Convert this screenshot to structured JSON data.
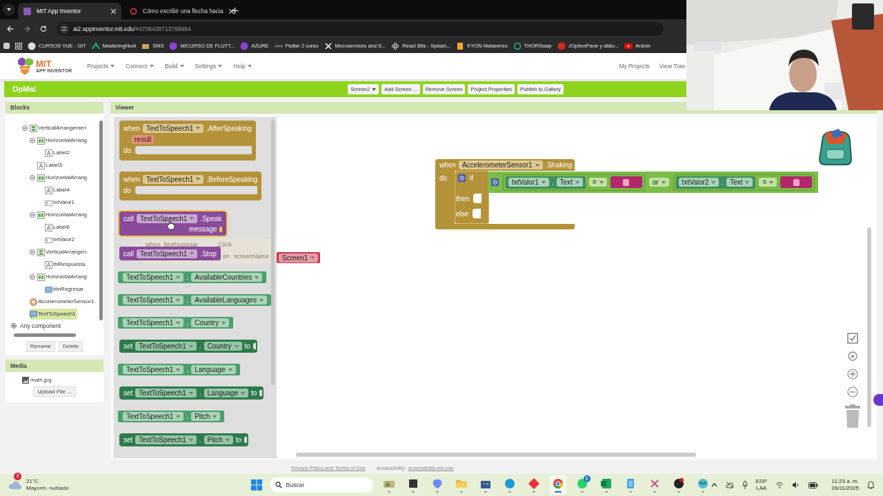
{
  "browser": {
    "tabs": [
      {
        "title": "MIT App Inventor",
        "selected": true
      },
      {
        "title": "Cómo escribir una flecha hacia",
        "selected": false
      }
    ],
    "address": {
      "host": "ai2.appinventor.mit.edu",
      "path": "/#4706438713769984"
    },
    "bookmarks": [
      {
        "label": "CURSOS VUE - GIT",
        "kind": "round"
      },
      {
        "label": "MasteringNuxt",
        "kind": "nuxt"
      },
      {
        "label": "SMS",
        "kind": "mail"
      },
      {
        "label": "MICURSO DE FLUTT...",
        "kind": "shield"
      },
      {
        "label": "AZURE",
        "kind": "shield"
      },
      {
        "label": "Flutter 2 curso",
        "kind": "dots"
      },
      {
        "label": "Microservices and S...",
        "kind": "x"
      },
      {
        "label": "React Bits - Splash...",
        "kind": "atom"
      },
      {
        "label": "KYON Metaverso",
        "kind": "bookmark"
      },
      {
        "label": "THORSwap",
        "kind": "ring"
      },
      {
        "label": "JOptionPane y diálo...",
        "kind": "java"
      },
      {
        "label": "Arduin",
        "kind": "play"
      }
    ]
  },
  "app": {
    "logo_title": "MIT",
    "logo_subtitle": "APP INVENTOR",
    "nav": [
      "Projects",
      "Connect",
      "Build",
      "Settings",
      "Help"
    ],
    "nav_right": [
      "My Projects",
      "View Tras"
    ],
    "project": "OpMat",
    "screen": "Screen2",
    "toolbar": [
      "Add Screen ...",
      "Remove Screen",
      "Project Properties",
      "Publish to Gallery"
    ]
  },
  "blocks_panel": {
    "title": "Blocks",
    "tree": [
      {
        "label": "VerticalArrangemen",
        "kind": "vertical",
        "expanded": true,
        "selected": false,
        "children": [
          {
            "label": "HorizontalArrang",
            "kind": "horizontal",
            "expanded": true,
            "selected": false,
            "children": [
              {
                "label": "Label2",
                "kind": "label",
                "selected": false
              }
            ]
          },
          {
            "label": "Label3",
            "kind": "label",
            "selected": false
          },
          {
            "label": "HorizontalArrang",
            "kind": "horizontal",
            "expanded": true,
            "selected": false,
            "children": [
              {
                "label": "Label4",
                "kind": "label",
                "selected": false
              },
              {
                "label": "txtValor1",
                "kind": "textbox",
                "selected": false
              }
            ]
          },
          {
            "label": "HorizontalArrang",
            "kind": "horizontal",
            "expanded": true,
            "selected": false,
            "children": [
              {
                "label": "Label6",
                "kind": "label",
                "selected": false
              },
              {
                "label": "txtValor2",
                "kind": "textbox",
                "selected": false
              }
            ]
          },
          {
            "label": "VerticalArrangen",
            "kind": "vertical",
            "expanded": true,
            "selected": false,
            "children": [
              {
                "label": "lblRespuesta",
                "kind": "label",
                "selected": false
              }
            ]
          },
          {
            "label": "HorizontalArrang",
            "kind": "horizontal",
            "expanded": true,
            "selected": false,
            "children": [
              {
                "label": "btnRegresar",
                "kind": "button",
                "selected": false
              }
            ]
          }
        ]
      },
      {
        "label": "AccelerometerSensor1",
        "kind": "sensor",
        "selected": false
      },
      {
        "label": "TextToSpeech1",
        "kind": "speech",
        "selected": true
      }
    ],
    "any": {
      "label": "Any component",
      "expanded": false
    },
    "buttons": [
      "Rename",
      "Delete"
    ]
  },
  "media_panel": {
    "title": "Media",
    "files": [
      "math.jpg"
    ],
    "upload": "Upload File ..."
  },
  "viewer": {
    "title": "Viewer",
    "drawer": [
      {
        "kind": "event",
        "keyword": "when",
        "component": "TextToSpeech1",
        "member": ".AfterSpeaking",
        "param": "result",
        "body": "do",
        "selected": false
      },
      {
        "kind": "event",
        "keyword": "when",
        "component": "TextToSpeech1",
        "member": ".BeforeSpeaking",
        "body": "do",
        "selected": false
      },
      {
        "kind": "call",
        "keyword": "call",
        "component": "TextToSpeech1",
        "member": ".Speak",
        "arg": "message",
        "selected": true
      },
      {
        "kind": "call",
        "keyword": "call",
        "component": "TextToSpeech1",
        "member": ".Stop",
        "selected": false
      },
      {
        "kind": "getter",
        "component": "TextToSpeech1",
        "separator": ".",
        "property": "AvailableCountries",
        "selected": false
      },
      {
        "kind": "getter",
        "component": "TextToSpeech1",
        "separator": ".",
        "property": "AvailableLanguages",
        "selected": false
      },
      {
        "kind": "getter",
        "component": "TextToSpeech1",
        "separator": ".",
        "property": "Country",
        "selected": false
      },
      {
        "kind": "setter",
        "keyword": "set",
        "component": "TextToSpeech1",
        "separator": ".",
        "property": "Country",
        "to": "to",
        "selected": false
      },
      {
        "kind": "getter",
        "component": "TextToSpeech1",
        "separator": ".",
        "property": "Language",
        "selected": false
      },
      {
        "kind": "setter",
        "keyword": "set",
        "component": "TextToSpeech1",
        "separator": ".",
        "property": "Language",
        "to": "to",
        "selected": false
      },
      {
        "kind": "getter",
        "component": "TextToSpeech1",
        "separator": ".",
        "property": "Pitch",
        "selected": false
      },
      {
        "kind": "setter",
        "keyword": "set",
        "component": "TextToSpeech1",
        "separator": ".",
        "property": "Pitch",
        "to": "to",
        "selected": false
      }
    ],
    "ghost": {
      "keyword": "when",
      "component": "btnRegresar",
      "member": ".Click",
      "row2": "en",
      "param": "screenName"
    },
    "event": {
      "keyword": "when",
      "component": "AccelerometerSensor1",
      "member": ".Shaking",
      "body": "do",
      "if": "if",
      "then": "then",
      "else": "else"
    },
    "condition": {
      "operator": "or",
      "left": {
        "component": "txtValor1",
        "separator": ".",
        "property": "Text",
        "compare": "="
      },
      "right": {
        "component": "txtValor2",
        "separator": ".",
        "property": "Text",
        "compare": "="
      }
    },
    "screen_block": "Screen1"
  },
  "footer": {
    "privacy": "Privacy Policy and Terms of Use",
    "accessibility_label": "Accessibility:",
    "accessibility_link": "accessibility.mit.edu"
  },
  "taskbar": {
    "weather": {
      "temp": "21°C",
      "condition": "Mayorm. nublado",
      "badge": "3"
    },
    "search": "Buscar",
    "apps": [
      {
        "kind": "landscape",
        "selected": false
      },
      {
        "kind": "terminal",
        "selected": false
      },
      {
        "kind": "copilot",
        "selected": false
      },
      {
        "kind": "folder",
        "selected": false
      },
      {
        "kind": "store",
        "selected": false
      },
      {
        "kind": "edge",
        "selected": false
      },
      {
        "kind": "diamond",
        "selected": false
      },
      {
        "kind": "chrome",
        "selected": true
      },
      {
        "kind": "whatsapp",
        "selected": false,
        "badge": "5"
      },
      {
        "kind": "excel",
        "selected": false
      },
      {
        "kind": "notepad",
        "selected": false
      },
      {
        "kind": "snip",
        "selected": false
      },
      {
        "kind": "recorder",
        "selected": false
      },
      {
        "kind": "globe",
        "selected": false
      }
    ],
    "tray": {
      "lang": "ESP",
      "layout": "LAA",
      "time": "11:23 a. m.",
      "date": "26/11/2025"
    }
  }
}
